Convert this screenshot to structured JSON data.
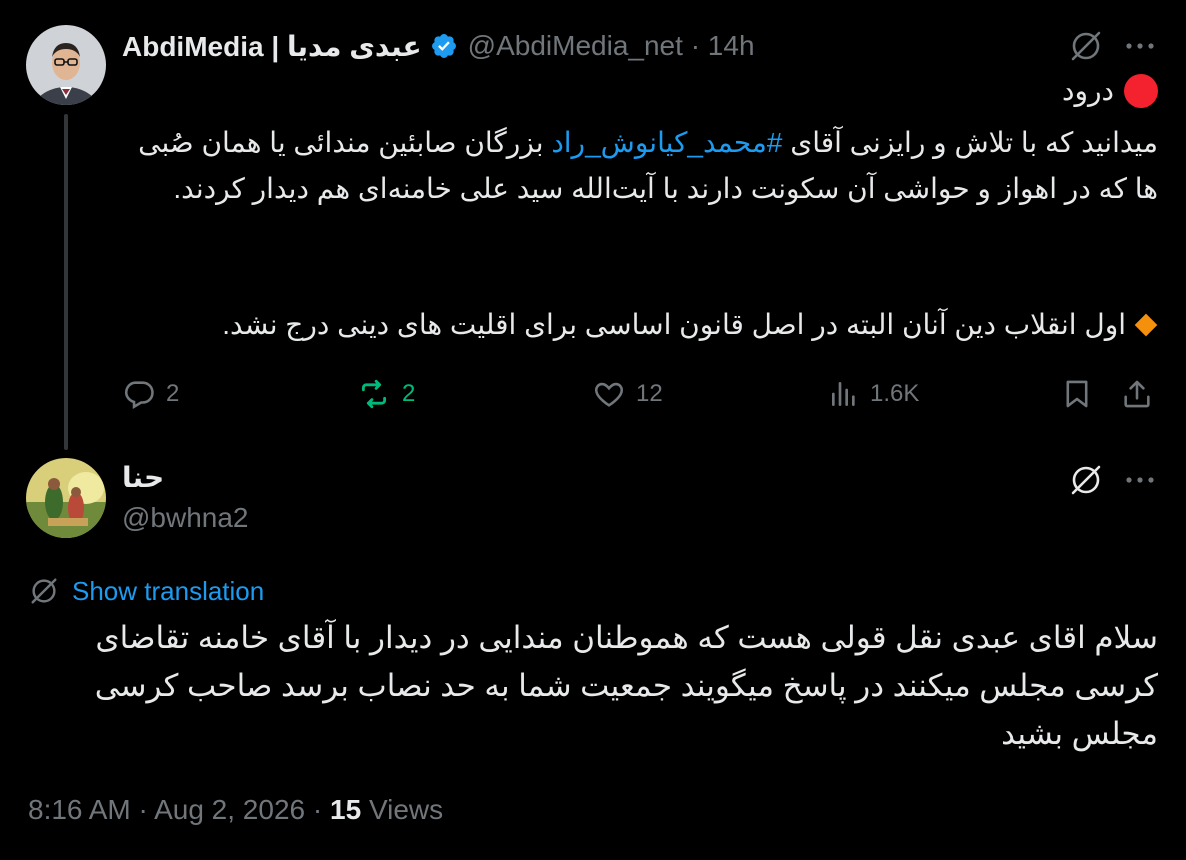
{
  "tweet1": {
    "display_name": "AbdiMedia | عبدی مدیا",
    "handle": "@AbdiMedia_net",
    "separator": "·",
    "time": "14h",
    "greeting": "درود",
    "para1_before": "میدانید که با تلاش و رایزنی آقای ",
    "hashtag": "#محمد_کیانوش_راد",
    "para1_after": " بزرگان صابئین مندائی یا همان صُبی ها که در اهواز و حواشی آن سکونت دارند با آیت‌الله سید علی خامنه‌ای هم دیدار کردند.",
    "para2": "اول انقلاب دین آنان البته در اصل قانون اساسی برای اقلیت های دینی درج نشد.",
    "replies": "2",
    "reposts": "2",
    "likes": "12",
    "views": "1.6K",
    "colors": {
      "retweet": "#00ba7c",
      "link": "#1d9bf0",
      "verified": "#1d9bf0",
      "red_dot": "#f4212e",
      "diamond": "#f4900c"
    }
  },
  "tweet2": {
    "display_name": "حنا",
    "handle": "@bwhna2",
    "translate_label": "Show translation",
    "text": "سلام اقای عبدی نقل قولی هست که هموطنان مندایی در دیدار با آقای خامنه تقاضای کرسی مجلس میکنند در پاسخ میگویند جمعیت شما به حد نصاب برسد صاحب کرسی مجلس بشید",
    "time": "8:16 AM",
    "date": "Aug 2, 2026",
    "views_count": "15",
    "views_label": "Views",
    "separator": "·"
  },
  "icons": [
    "grok-icon",
    "more-icon",
    "verified-badge-icon",
    "reply-icon",
    "repost-icon",
    "like-icon",
    "views-icon",
    "bookmark-icon",
    "share-icon",
    "translate-icon"
  ]
}
